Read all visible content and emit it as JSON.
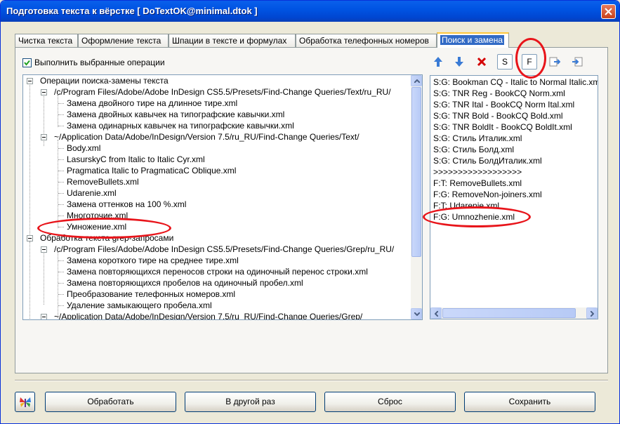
{
  "window": {
    "title": "Подготовка текста к вёрстке  [ DoTextOK@minimal.dtok ]"
  },
  "tabs": [
    {
      "label": "Чистка текста"
    },
    {
      "label": "Оформление текста"
    },
    {
      "label": "Шпации в тексте и формулах"
    },
    {
      "label": "Обработка телефонных номеров"
    },
    {
      "label": "Поиск и замена",
      "active": true
    }
  ],
  "options": {
    "run_selected_label": "Выполнить выбранные операции",
    "checked": true
  },
  "tree": {
    "rows": [
      {
        "text": "Операции поиска-замены текста"
      },
      {
        "text": "/c/Program Files/Adobe/Adobe InDesign CS5.5/Presets/Find-Change Queries/Text/ru_RU/"
      },
      {
        "text": "Замена двойного тире на длинное тире.xml"
      },
      {
        "text": "Замена двойных кавычек на типографские кавычки.xml"
      },
      {
        "text": "Замена одинарных кавычек на типографские кавычки.xml"
      },
      {
        "text": "~/Application Data/Adobe/InDesign/Version 7.5/ru_RU/Find-Change Queries/Text/"
      },
      {
        "text": "Body.xml"
      },
      {
        "text": "LasurskyC from Italic to Italic Cyr.xml"
      },
      {
        "text": "Pragmatica Italic to PragmaticaC Oblique.xml"
      },
      {
        "text": "RemoveBullets.xml"
      },
      {
        "text": "Udarenie.xml"
      },
      {
        "text": "Замена оттенков на 100 %.xml"
      },
      {
        "text": "Многоточие.xml"
      },
      {
        "text": "Умножение.xml"
      },
      {
        "text": "Обработка текста grep-запросами"
      },
      {
        "text": "/c/Program Files/Adobe/Adobe InDesign CS5.5/Presets/Find-Change Queries/Grep/ru_RU/"
      },
      {
        "text": "Замена короткого тире на среднее тире.xml"
      },
      {
        "text": "Замена повторяющихся переносов строки на одиночный перенос строки.xml"
      },
      {
        "text": "Замена повторяющихся пробелов на одиночный пробел.xml"
      },
      {
        "text": "Преобразование телефонных номеров.xml"
      },
      {
        "text": "Удаление замыкающего пробела.xml"
      },
      {
        "text": "~/Application Data/Adobe/InDesign/Version 7.5/ru_RU/Find-Change Queries/Grep/"
      }
    ]
  },
  "toolbar": {
    "move_up_icon": "arrow-up",
    "move_down_icon": "arrow-down",
    "delete_icon": "red-x",
    "s_label": "S",
    "f_label": "F",
    "export_icon": "export",
    "import_icon": "import"
  },
  "selected_list": {
    "items": [
      "S:G: Bookman CQ - Italic to Normal Italic.xml",
      "S:G: TNR Reg - BookCQ Norm.xml",
      "S:G: TNR Ital - BookCQ Norm Ital.xml",
      "S:G: TNR Bold - BookCQ Bold.xml",
      "S:G: TNR BoldIt - BookCQ BoldIt.xml",
      "S:G: Стиль Италик.xml",
      "S:G: Стиль Болд.xml",
      "S:G: Стиль БолдИталик.xml",
      ">>>>>>>>>>>>>>>>>>",
      "F:T: RemoveBullets.xml",
      "F:G: RemoveNon-joiners.xml",
      "F:T: Udarenie.xml",
      "F:G: Umnozhenie.xml"
    ]
  },
  "buttons": {
    "process": "Обработать",
    "later": "В другой раз",
    "reset": "Сброс",
    "save": "Сохранить"
  },
  "colors": {
    "title_bar": "#0054E3",
    "tab_active": "#316AC5",
    "annotation": "#E8141A",
    "up_down_arrows": "#3A7BD5",
    "delete_x": "#D40000"
  }
}
